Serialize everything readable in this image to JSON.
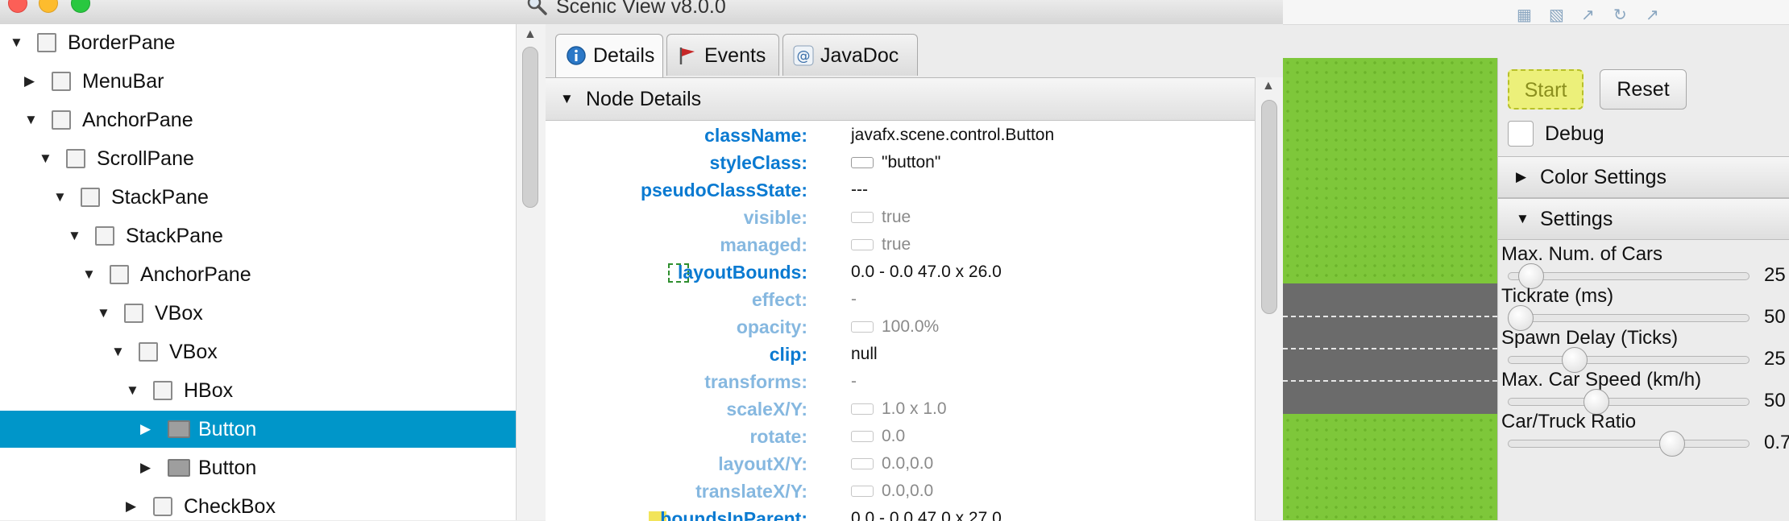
{
  "window": {
    "title": "Scenic View v8.0.0",
    "title_icon": "magnifier-icon"
  },
  "tree": {
    "items": [
      {
        "label": "BorderPane",
        "expanded": true,
        "icon": "borderpane-icon"
      },
      {
        "label": "MenuBar",
        "expanded": false,
        "icon": "menubar-icon"
      },
      {
        "label": "AnchorPane",
        "expanded": true,
        "icon": "anchorpane-icon"
      },
      {
        "label": "ScrollPane",
        "expanded": true,
        "icon": "scrollpane-icon"
      },
      {
        "label": "StackPane",
        "expanded": true,
        "icon": "stackpane-icon"
      },
      {
        "label": "StackPane",
        "expanded": true,
        "icon": "stackpane-icon"
      },
      {
        "label": "AnchorPane",
        "expanded": true,
        "icon": "anchorpane-icon"
      },
      {
        "label": "VBox",
        "expanded": true,
        "icon": "vbox-icon"
      },
      {
        "label": "VBox",
        "expanded": true,
        "icon": "vbox-icon"
      },
      {
        "label": "HBox",
        "expanded": true,
        "icon": "hbox-icon"
      },
      {
        "label": "Button",
        "expanded": false,
        "icon": "button-icon",
        "selected": true
      },
      {
        "label": "Button",
        "expanded": false,
        "icon": "button-icon"
      },
      {
        "label": "CheckBox",
        "expanded": false,
        "icon": "checkbox-icon"
      }
    ]
  },
  "tabs": [
    {
      "label": "Details",
      "icon": "info-icon",
      "active": true
    },
    {
      "label": "Events",
      "icon": "flag-icon",
      "active": false
    },
    {
      "label": "JavaDoc",
      "icon": "at-icon",
      "active": false
    }
  ],
  "node_details": {
    "title": "Node Details",
    "properties": [
      {
        "name": "className:",
        "value": "javafx.scene.control.Button",
        "dim": false,
        "box": false
      },
      {
        "name": "styleClass:",
        "value": "\"button\"",
        "dim": false,
        "box": true
      },
      {
        "name": "pseudoClassState:",
        "value": "---",
        "dim": false,
        "box": false
      },
      {
        "name": "visible:",
        "value": "true",
        "dim": true,
        "box": true
      },
      {
        "name": "managed:",
        "value": "true",
        "dim": true,
        "box": true
      },
      {
        "name": "layoutBounds:",
        "value": "0.0 - 0.0  47.0 x 26.0",
        "dim": false,
        "box": false
      },
      {
        "name": "effect:",
        "value": "-",
        "dim": true,
        "box": false
      },
      {
        "name": "opacity:",
        "value": "100.0%",
        "dim": true,
        "box": true
      },
      {
        "name": "clip:",
        "value": "null",
        "dim": false,
        "box": false
      },
      {
        "name": "transforms:",
        "value": "-",
        "dim": true,
        "box": false
      },
      {
        "name": "scaleX/Y:",
        "value": "1.0 x 1.0",
        "dim": true,
        "box": true
      },
      {
        "name": "rotate:",
        "value": "0.0",
        "dim": true,
        "box": true
      },
      {
        "name": "layoutX/Y:",
        "value": "0.0,0.0",
        "dim": true,
        "box": true
      },
      {
        "name": "translateX/Y:",
        "value": "0.0,0.0",
        "dim": true,
        "box": true
      },
      {
        "name": "boundsInParent:",
        "value": "0.0 - 0.0  47.0 x 27.0",
        "dim": false,
        "box": false
      }
    ]
  },
  "app": {
    "buttons": {
      "start": "Start",
      "reset": "Reset"
    },
    "debug_label": "Debug",
    "sections": {
      "color_settings": "Color Settings",
      "settings": "Settings"
    },
    "sliders": [
      {
        "label": "Max. Num. of Cars",
        "value": "25",
        "level": 0.05
      },
      {
        "label": "Tickrate (ms)",
        "value": "50",
        "level": 0.0
      },
      {
        "label": "Spawn Delay (Ticks)",
        "value": "25",
        "level": 0.25
      },
      {
        "label": "Max. Car Speed (km/h)",
        "value": "50",
        "level": 0.35
      },
      {
        "label": "Car/Truck Ratio",
        "value": "0.7",
        "level": 0.7
      }
    ]
  },
  "colors": {
    "selection": "#0096c9",
    "property_name": "#0a7ad1",
    "grass": "#7ec73a",
    "road": "#6b6b6b"
  }
}
